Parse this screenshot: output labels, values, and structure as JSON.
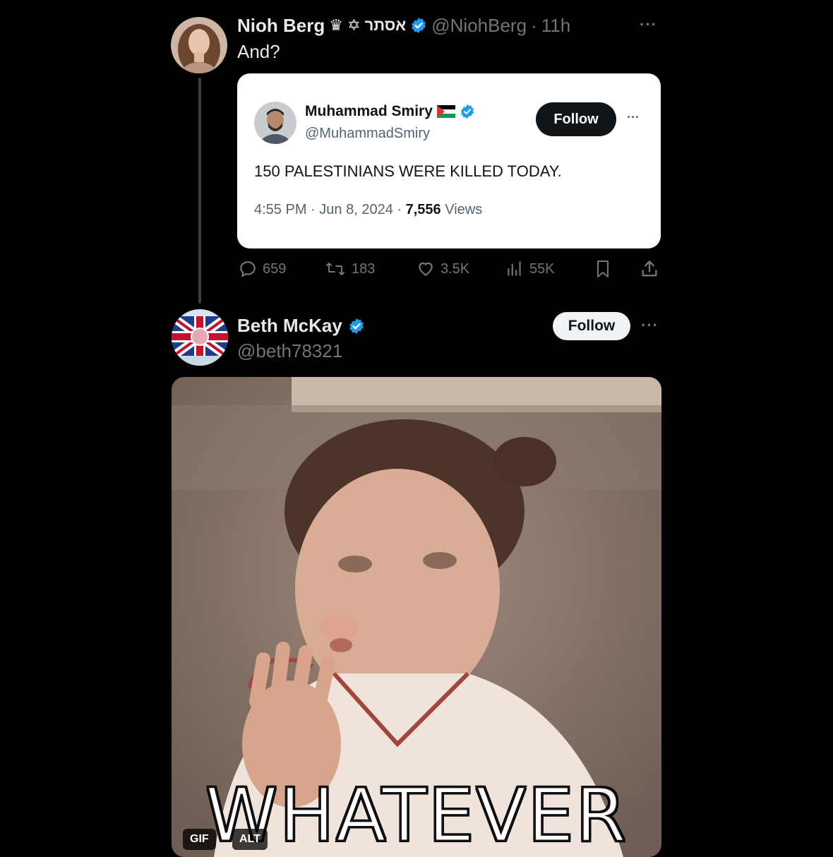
{
  "tweet1": {
    "display_name": "Nioh Berg",
    "name_symbols": "♛ ✡ אסתר",
    "handle": "@NiohBerg",
    "dot": "·",
    "time": "11h",
    "text": "And?",
    "more": "···"
  },
  "quoted": {
    "display_name": "Muhammad Smiry",
    "handle": "@MuhammadSmiry",
    "follow_label": "Follow",
    "more": "···",
    "text": "150 PALESTINIANS WERE KILLED TODAY.",
    "time": "4:55 PM",
    "dot1": "·",
    "date": "Jun 8, 2024",
    "dot2": "·",
    "views_count": "7,556",
    "views_label": "Views"
  },
  "actions": {
    "replies": "659",
    "reposts": "183",
    "likes": "3.5K",
    "views": "55K"
  },
  "tweet2": {
    "display_name": "Beth McKay",
    "handle": "@beth78321",
    "follow_label": "Follow",
    "more": "···"
  },
  "media": {
    "caption": "WHATEVER",
    "gif_badge": "GIF",
    "alt_badge": "ALT"
  },
  "colors": {
    "background": "#000000",
    "verified": "#1d9bf0",
    "muted": "#71767b"
  }
}
